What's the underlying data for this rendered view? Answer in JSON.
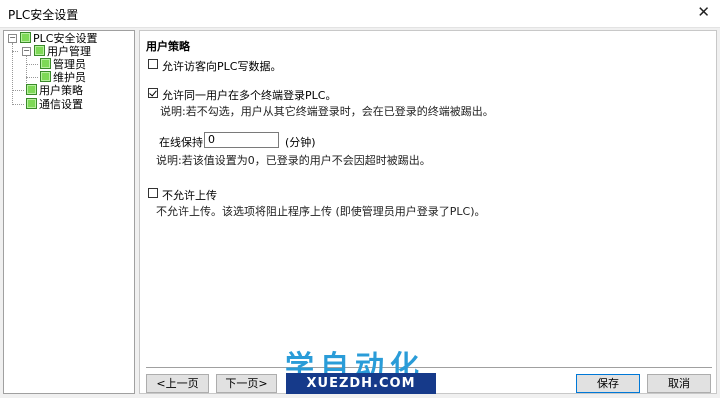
{
  "window": {
    "title": "PLC安全设置",
    "close_glyph": "✕"
  },
  "tree": {
    "root": {
      "label": "PLC安全设置",
      "expander": "−"
    },
    "user_mgmt": {
      "label": "用户管理",
      "expander": "−"
    },
    "admin": {
      "label": "管理员"
    },
    "maintainer": {
      "label": "维护员"
    },
    "user_policy": {
      "label": "用户策略"
    },
    "comm": {
      "label": "通信设置"
    }
  },
  "panel": {
    "heading": "用户策略",
    "allow_write": {
      "label": "允许访客向PLC写数据。",
      "checked": false
    },
    "multi_login": {
      "label": "允许同一用户在多个终端登录PLC。",
      "checked": true,
      "description": "说明:若不勾选，用户从其它终端登录时，会在已登录的终端被踢出。"
    },
    "keep_online": {
      "label": "在线保持",
      "value": "0",
      "unit": "(分钟)",
      "description": "说明:若该值设置为0，已登录的用户不会因超时被踢出。"
    },
    "no_upload": {
      "label": "不允许上传",
      "checked": false,
      "description": "不允许上传。该选项将阻止程序上传 (即使管理员用户登录了PLC)。"
    }
  },
  "buttons": {
    "prev": "<上一页",
    "next": "下一页>",
    "save": "保存",
    "cancel": "取消"
  },
  "watermark": {
    "cn": "学自动化",
    "en": "XUEZDH.COM"
  },
  "colors": {
    "tree_icon": "#7ed957",
    "watermark_blue": "#2a9cd8",
    "watermark_bg": "#163a8a"
  }
}
